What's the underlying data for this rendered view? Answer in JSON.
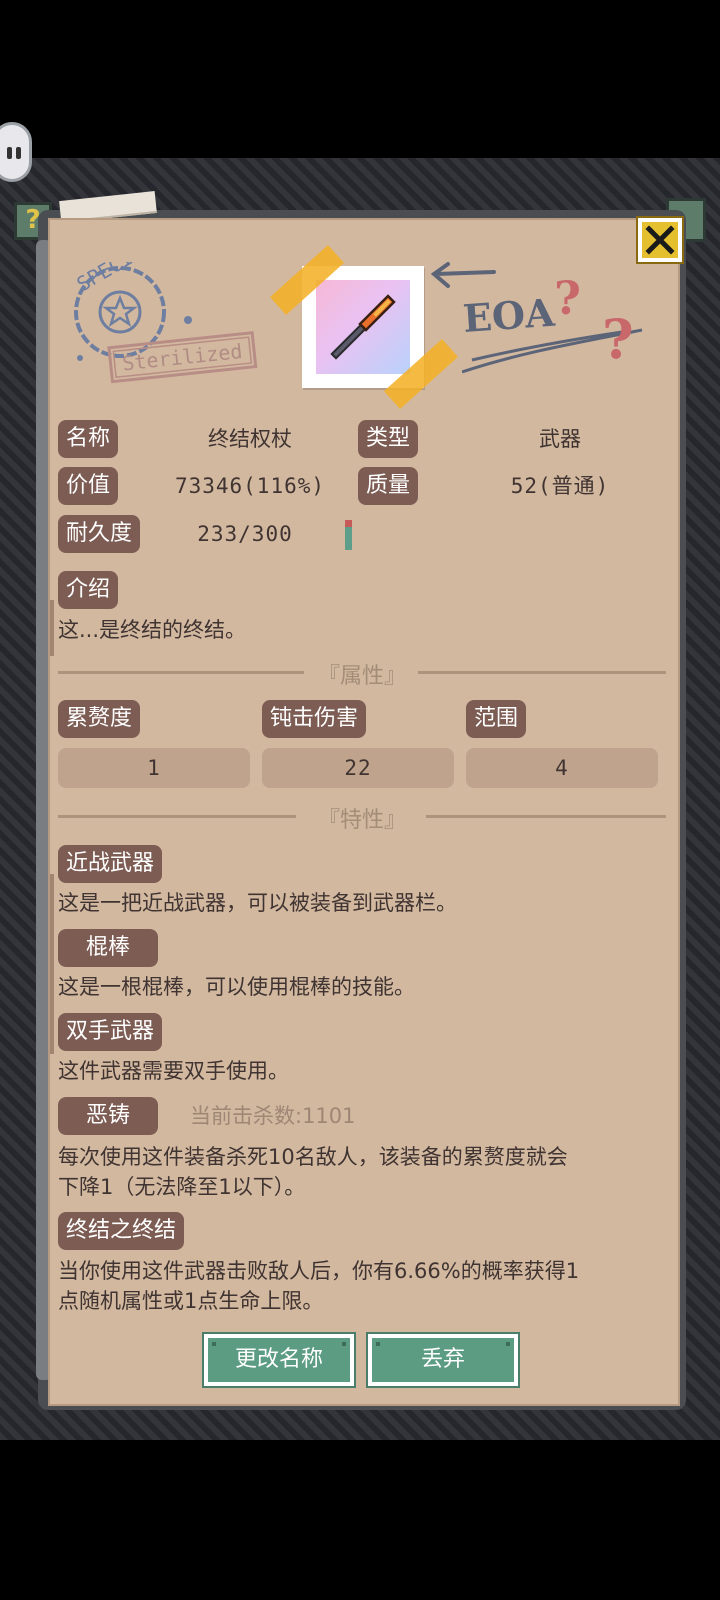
{
  "item": {
    "name_label": "名称",
    "name": "终结权杖",
    "type_label": "类型",
    "type": "武器",
    "value_label": "价值",
    "value": "73346(116%)",
    "quality_label": "质量",
    "quality": "52(普通)",
    "durability_label": "耐久度",
    "durability": "233/300",
    "durability_fraction": 0.777,
    "intro_label": "介绍",
    "intro": "这...是终结的终结。"
  },
  "decor": {
    "stamp_text": "Sterilized",
    "stamp_ring_text": "SPECIAL",
    "doodle_text": "EOA"
  },
  "attributes": {
    "title": "『属性』",
    "items": [
      {
        "label": "累赘度",
        "value": "1"
      },
      {
        "label": "钝击伤害",
        "value": "22"
      },
      {
        "label": "范围",
        "value": "4"
      }
    ]
  },
  "traits": {
    "title": "『特性』",
    "items": [
      {
        "label": "近战武器",
        "desc": "这是一把近战武器，可以被装备到武器栏。"
      },
      {
        "label": "棍棒",
        "desc": "这是一根棍棒，可以使用棍棒的技能。"
      },
      {
        "label": "双手武器",
        "desc": "这件武器需要双手使用。"
      },
      {
        "label": "恶铸",
        "hint": "当前击杀数:1101",
        "desc1": "每次使用这件装备杀死10名敌人，该装备的累赘度就会",
        "desc2": "下降1（无法降至1以下）。"
      },
      {
        "label": "终结之终结",
        "desc1": "当你使用这件武器击败敌人后，你有6.66%的概率获得1",
        "desc2": "点随机属性或1点生命上限。"
      }
    ]
  },
  "buttons": {
    "rename": "更改名称",
    "discard": "丢弃"
  },
  "icons": {
    "close": "close-x-icon",
    "pause": "pause-icon",
    "help": "question-icon",
    "item": "scepter-icon"
  },
  "colors": {
    "panel": "#d3b8a0",
    "label_bg": "#7d5c54",
    "button": "#5c9c83",
    "close": "#e5c02e",
    "tape": "#f2b028"
  }
}
